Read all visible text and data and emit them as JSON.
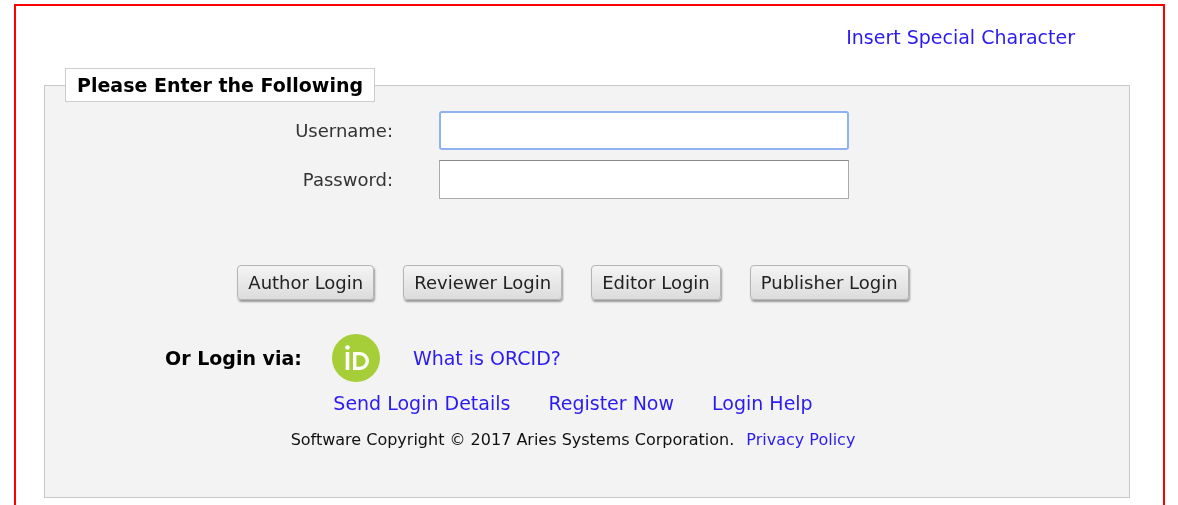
{
  "top_link": "Insert Special Character",
  "form": {
    "legend": "Please Enter the Following",
    "fields": [
      {
        "label": "Username:",
        "focused": true
      },
      {
        "label": "Password:",
        "focused": false
      }
    ],
    "buttons": [
      "Author Login",
      "Reviewer Login",
      "Editor Login",
      "Publisher Login"
    ],
    "orcid": {
      "label": "Or Login via:",
      "link": "What is ORCID?"
    },
    "links": [
      "Send Login Details",
      "Register Now",
      "Login Help"
    ],
    "copyright": "Software Copyright © 2017 Aries Systems Corporation.",
    "privacy_link": "Privacy Policy"
  }
}
